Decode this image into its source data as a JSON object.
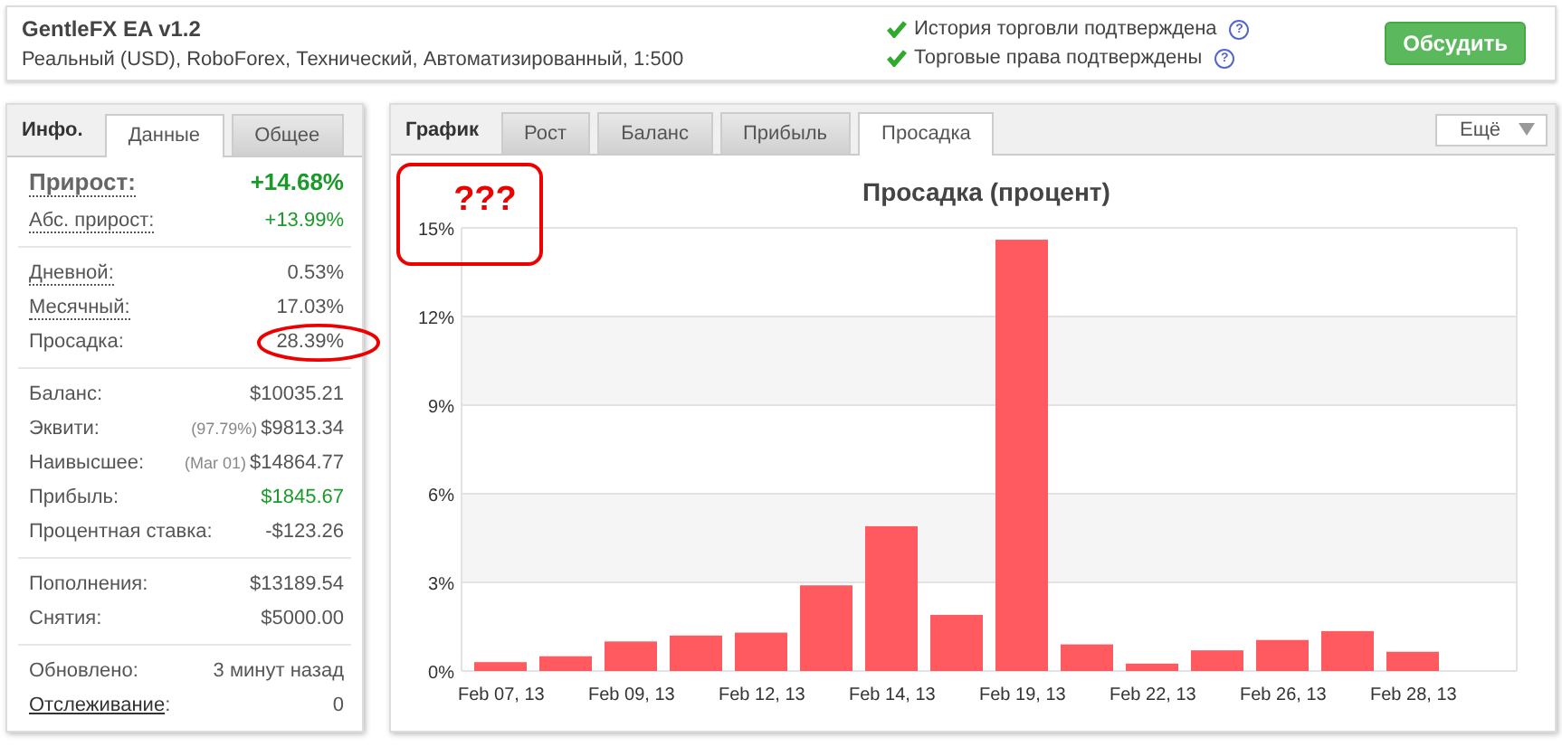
{
  "header": {
    "title": "GentleFX EA v1.2",
    "subtitle": "Реальный (USD), RoboForex, Технический, Автоматизированный, 1:500",
    "checks": [
      {
        "text": "История торговли подтверждена",
        "verified": true,
        "help": "?"
      },
      {
        "text": "Торговые права подтверждены",
        "verified": true,
        "help": "?"
      }
    ],
    "discuss_button": "Обсудить"
  },
  "info_panel": {
    "heading": "Инфо.",
    "tabs": [
      {
        "label": "Данные",
        "selected": true
      },
      {
        "label": "Общее",
        "selected": false
      }
    ],
    "groups": [
      [
        {
          "kind": "headline",
          "label": "Прирост:",
          "value": "+14.68%",
          "positive": true,
          "dotted": true,
          "link": false
        },
        {
          "kind": "stat",
          "label": "Абс. прирост:",
          "value": "+13.99%",
          "positive": true,
          "dotted": true,
          "link": false
        }
      ],
      [
        {
          "kind": "stat",
          "label": "Дневной:",
          "value": "0.53%",
          "positive": false,
          "dotted": true,
          "link": false
        },
        {
          "kind": "stat",
          "label": "Месячный:",
          "value": "17.03%",
          "positive": false,
          "dotted": true,
          "link": false
        },
        {
          "kind": "stat",
          "label": "Просадка:",
          "value": "28.39%",
          "positive": false,
          "dotted": false,
          "link": false,
          "circled": true
        }
      ],
      [
        {
          "kind": "stat",
          "label": "Баланс:",
          "value": "$10035.21",
          "positive": false,
          "dotted": false,
          "link": false
        },
        {
          "kind": "stat",
          "label": "Эквити:",
          "note": "(97.79%)",
          "value": "$9813.34",
          "positive": false,
          "dotted": false,
          "link": false
        },
        {
          "kind": "stat",
          "label": "Наивысшее:",
          "note": "(Mar 01)",
          "value": "$14864.77",
          "positive": false,
          "dotted": false,
          "link": false
        },
        {
          "kind": "stat",
          "label": "Прибыль:",
          "value": "$1845.67",
          "positive": true,
          "dotted": false,
          "link": false
        },
        {
          "kind": "stat",
          "label": "Процентная ставка:",
          "value": "-$123.26",
          "positive": false,
          "dotted": false,
          "link": false
        }
      ],
      [
        {
          "kind": "stat",
          "label": "Пополнения:",
          "value": "$13189.54",
          "positive": false,
          "dotted": false,
          "link": false
        },
        {
          "kind": "stat",
          "label": "Снятия:",
          "value": "$5000.00",
          "positive": false,
          "dotted": false,
          "link": false
        }
      ],
      [
        {
          "kind": "stat",
          "label": "Обновлено:",
          "value": "3 минут назад",
          "positive": false,
          "dotted": false,
          "link": false
        },
        {
          "kind": "stat",
          "label": "Отслеживание",
          "suffix": ":",
          "value": "0",
          "positive": false,
          "dotted": false,
          "link": true
        }
      ]
    ]
  },
  "chart_panel": {
    "heading": "График",
    "tabs": [
      {
        "label": "Рост",
        "selected": false
      },
      {
        "label": "Баланс",
        "selected": false
      },
      {
        "label": "Прибыль",
        "selected": false
      },
      {
        "label": "Просадка",
        "selected": true
      }
    ],
    "more_button": "Ещё",
    "annotation": "???",
    "chart_data": {
      "type": "bar",
      "title": "Просадка (процент)",
      "grid": true,
      "categories": [
        "Feb 07, 13",
        null,
        "Feb 09, 13",
        null,
        "Feb 12, 13",
        null,
        "Feb 14, 13",
        null,
        "Feb 19, 13",
        null,
        "Feb 22, 13",
        null,
        "Feb 26, 13",
        null,
        "Feb 28, 13"
      ],
      "series": [
        {
          "color": "#ff5a5f",
          "values": [
            0.3,
            0.5,
            1.0,
            1.2,
            1.3,
            2.9,
            4.9,
            1.9,
            14.6,
            0.9,
            0.25,
            0.7,
            1.05,
            1.35,
            0.65
          ]
        }
      ],
      "ylim": [
        0,
        15
      ],
      "yticks": [
        {
          "value": 0,
          "label": "0%"
        },
        {
          "value": 3,
          "label": "3%"
        },
        {
          "value": 6,
          "label": "6%"
        },
        {
          "value": 9,
          "label": "9%"
        },
        {
          "value": 12,
          "label": "12%"
        },
        {
          "value": 15,
          "label": "15%"
        }
      ]
    }
  }
}
